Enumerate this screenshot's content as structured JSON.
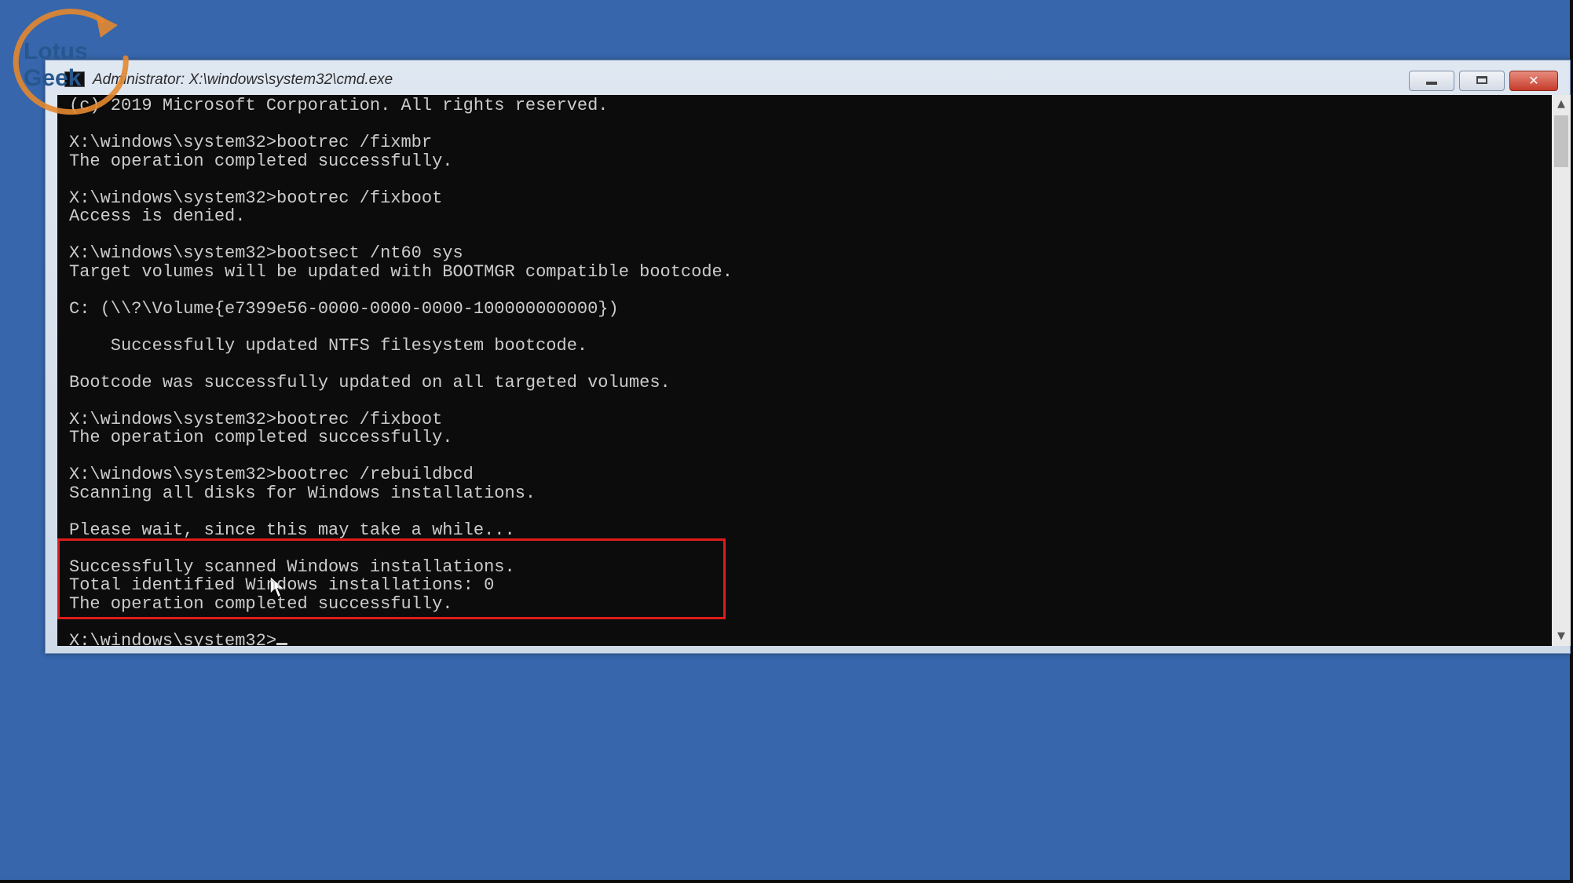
{
  "window": {
    "title": "Administrator: X:\\windows\\system32\\cmd.exe",
    "minimize_label": "",
    "maximize_label": "",
    "close_label": "✕"
  },
  "console": {
    "lines": [
      "(c) 2019 Microsoft Corporation. All rights reserved.",
      "",
      "X:\\windows\\system32>bootrec /fixmbr",
      "The operation completed successfully.",
      "",
      "X:\\windows\\system32>bootrec /fixboot",
      "Access is denied.",
      "",
      "X:\\windows\\system32>bootsect /nt60 sys",
      "Target volumes will be updated with BOOTMGR compatible bootcode.",
      "",
      "C: (\\\\?\\Volume{e7399e56-0000-0000-0000-100000000000})",
      "",
      "    Successfully updated NTFS filesystem bootcode.",
      "",
      "Bootcode was successfully updated on all targeted volumes.",
      "",
      "X:\\windows\\system32>bootrec /fixboot",
      "The operation completed successfully.",
      "",
      "X:\\windows\\system32>bootrec /rebuildbcd",
      "Scanning all disks for Windows installations.",
      "",
      "Please wait, since this may take a while...",
      "",
      "Successfully scanned Windows installations.",
      "Total identified Windows installations: 0",
      "The operation completed successfully.",
      "",
      "X:\\windows\\system32>"
    ]
  },
  "watermark": {
    "line1": "Lotus",
    "line2": "Geek"
  },
  "colors": {
    "desktop": "#3766ac",
    "console_bg": "#0c0c0c",
    "console_text": "#cccccc",
    "highlight": "#e01b1b",
    "logo_ring": "#e3872f"
  },
  "icons": {
    "window_icon": "cmd-icon",
    "scroll_up": "chevron-up-icon",
    "scroll_down": "chevron-down-icon",
    "pointer": "mouse-pointer-icon"
  }
}
